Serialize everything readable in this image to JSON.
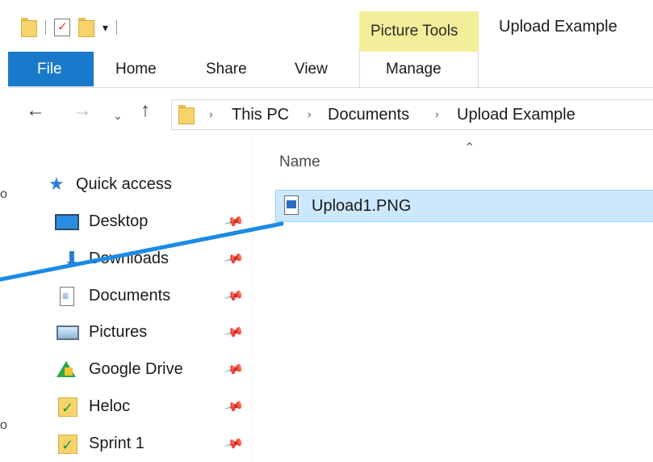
{
  "titlebar": {
    "context_tab_group": "Picture Tools",
    "window_title": "Upload Example"
  },
  "ribbon": {
    "tabs": [
      "File",
      "Home",
      "Share",
      "View"
    ],
    "context_tab": "Manage"
  },
  "address_bar": {
    "crumbs": [
      "This PC",
      "Documents",
      "Upload Example"
    ]
  },
  "nav_pane": {
    "quick_access_label": "Quick access",
    "items": [
      {
        "label": "Desktop",
        "icon": "desktop-icon"
      },
      {
        "label": "Downloads",
        "icon": "download-arrow-icon"
      },
      {
        "label": "Documents",
        "icon": "document-icon"
      },
      {
        "label": "Pictures",
        "icon": "pictures-icon"
      },
      {
        "label": "Google Drive",
        "icon": "google-drive-icon"
      },
      {
        "label": "Heloc",
        "icon": "synced-folder-icon"
      },
      {
        "label": "Sprint 1",
        "icon": "synced-folder-icon"
      }
    ]
  },
  "file_list": {
    "column_header": "Name",
    "files": [
      {
        "name": "Upload1.PNG",
        "icon": "png-file-icon",
        "selected": true
      }
    ]
  },
  "colors": {
    "file_tab": "#1979ca",
    "context_tab_bg": "#f3ee9a",
    "selection_bg": "#cce8ff",
    "drag_line": "#1a8be6"
  }
}
